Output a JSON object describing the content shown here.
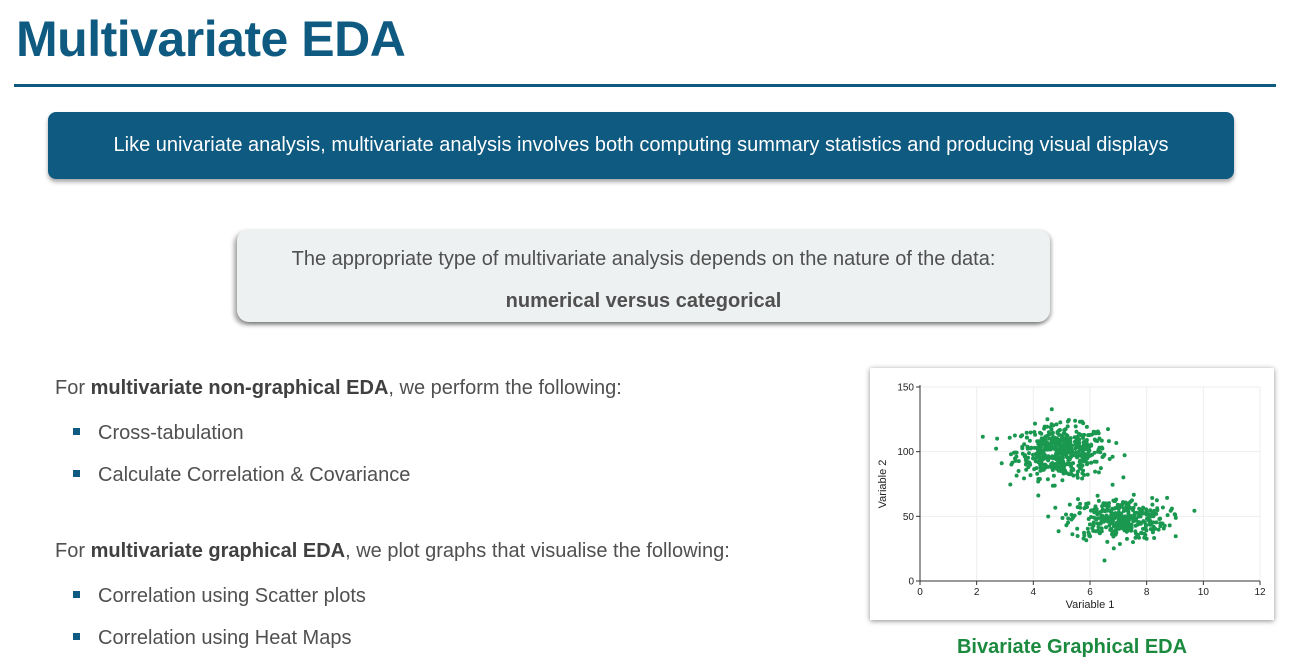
{
  "page": {
    "title": "Multivariate EDA",
    "banner": "Like univariate analysis, multivariate analysis involves both computing summary statistics and producing visual displays",
    "callout": {
      "line1": "The appropriate type of multivariate analysis depends on the nature of the data:",
      "line2": "numerical versus categorical"
    },
    "non_graphical": {
      "prefix": "For ",
      "bold": "multivariate non-graphical EDA",
      "suffix": ", we perform the following:",
      "bullets": [
        "Cross-tabulation",
        "Calculate Correlation & Covariance"
      ]
    },
    "graphical": {
      "prefix": "For ",
      "bold": "multivariate graphical EDA",
      "suffix": ", we plot graphs that visualise the following:",
      "bullets": [
        "Correlation using Scatter plots",
        "Correlation using Heat Maps"
      ]
    },
    "caption": "Bivariate Graphical EDA"
  },
  "colors": {
    "accent": "#0f5a80",
    "point": "#1a9850",
    "caption": "#1b8a3f"
  },
  "chart_data": {
    "type": "scatter",
    "xlabel": "Variable 1",
    "ylabel": "Variable 2",
    "xlim": [
      0,
      12
    ],
    "ylim": [
      0,
      150
    ],
    "xticks": [
      0,
      2,
      4,
      6,
      8,
      10,
      12
    ],
    "yticks": [
      0,
      50,
      100,
      150
    ],
    "grid": true,
    "clusters": [
      {
        "center": [
          5.0,
          100
        ],
        "spread": [
          0.8,
          10
        ],
        "n": 500
      },
      {
        "center": [
          7.0,
          48
        ],
        "spread": [
          0.85,
          8
        ],
        "n": 350
      }
    ]
  }
}
